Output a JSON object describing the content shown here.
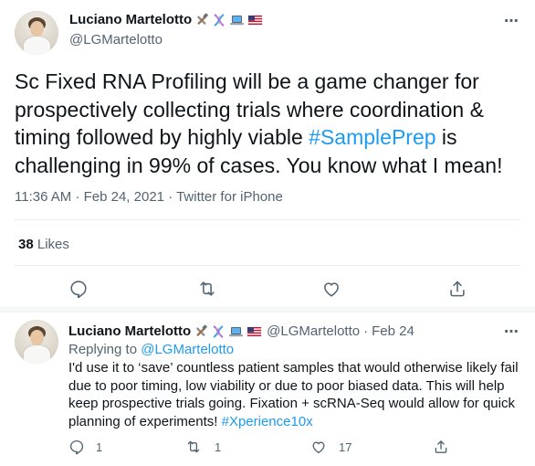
{
  "colors": {
    "accent": "#1d9bf0",
    "secondary_text": "#536471",
    "primary_text": "#0f1419"
  },
  "main_tweet": {
    "display_name": "Luciano Martelotto",
    "emojis": [
      "hammer-and-wrench-icon",
      "dna-icon",
      "laptop-icon",
      "us-flag-icon"
    ],
    "handle": "@LGMartelotto",
    "more_label": "⋯",
    "text_before": "Sc Fixed RNA Profiling will be a game changer for prospectively collecting trials where coordination & timing followed by highly viable ",
    "hashtag": "#SamplePrep",
    "text_after": " is challenging in 99% of cases. You know what I mean!",
    "time": "11:36 AM",
    "date": "Feb 24, 2021",
    "source": "Twitter for iPhone",
    "separator": "·",
    "likes_count": "38",
    "likes_label": "Likes",
    "actions": [
      "reply-icon",
      "retweet-icon",
      "like-icon",
      "share-icon"
    ]
  },
  "reply_tweet": {
    "display_name": "Luciano Martelotto",
    "emojis": [
      "hammer-and-wrench-icon",
      "dna-icon",
      "laptop-icon",
      "us-flag-icon"
    ],
    "handle": "@LGMartelotto",
    "separator": "·",
    "date": "Feb 24",
    "more_label": "⋯",
    "replying_prefix": "Replying to",
    "replying_handle": "@LGMartelotto",
    "text": "I'd use it to ‘save’ countless patient samples that would otherwise likely fail due to poor timing, low viability or due to poor biased data. This will help keep prospective trials going. Fixation + scRNA-Seq would allow for quick planning of experiments! ",
    "hashtag": "#Xperience10x",
    "reply_count": "1",
    "retweet_count": "1",
    "like_count": "17"
  }
}
